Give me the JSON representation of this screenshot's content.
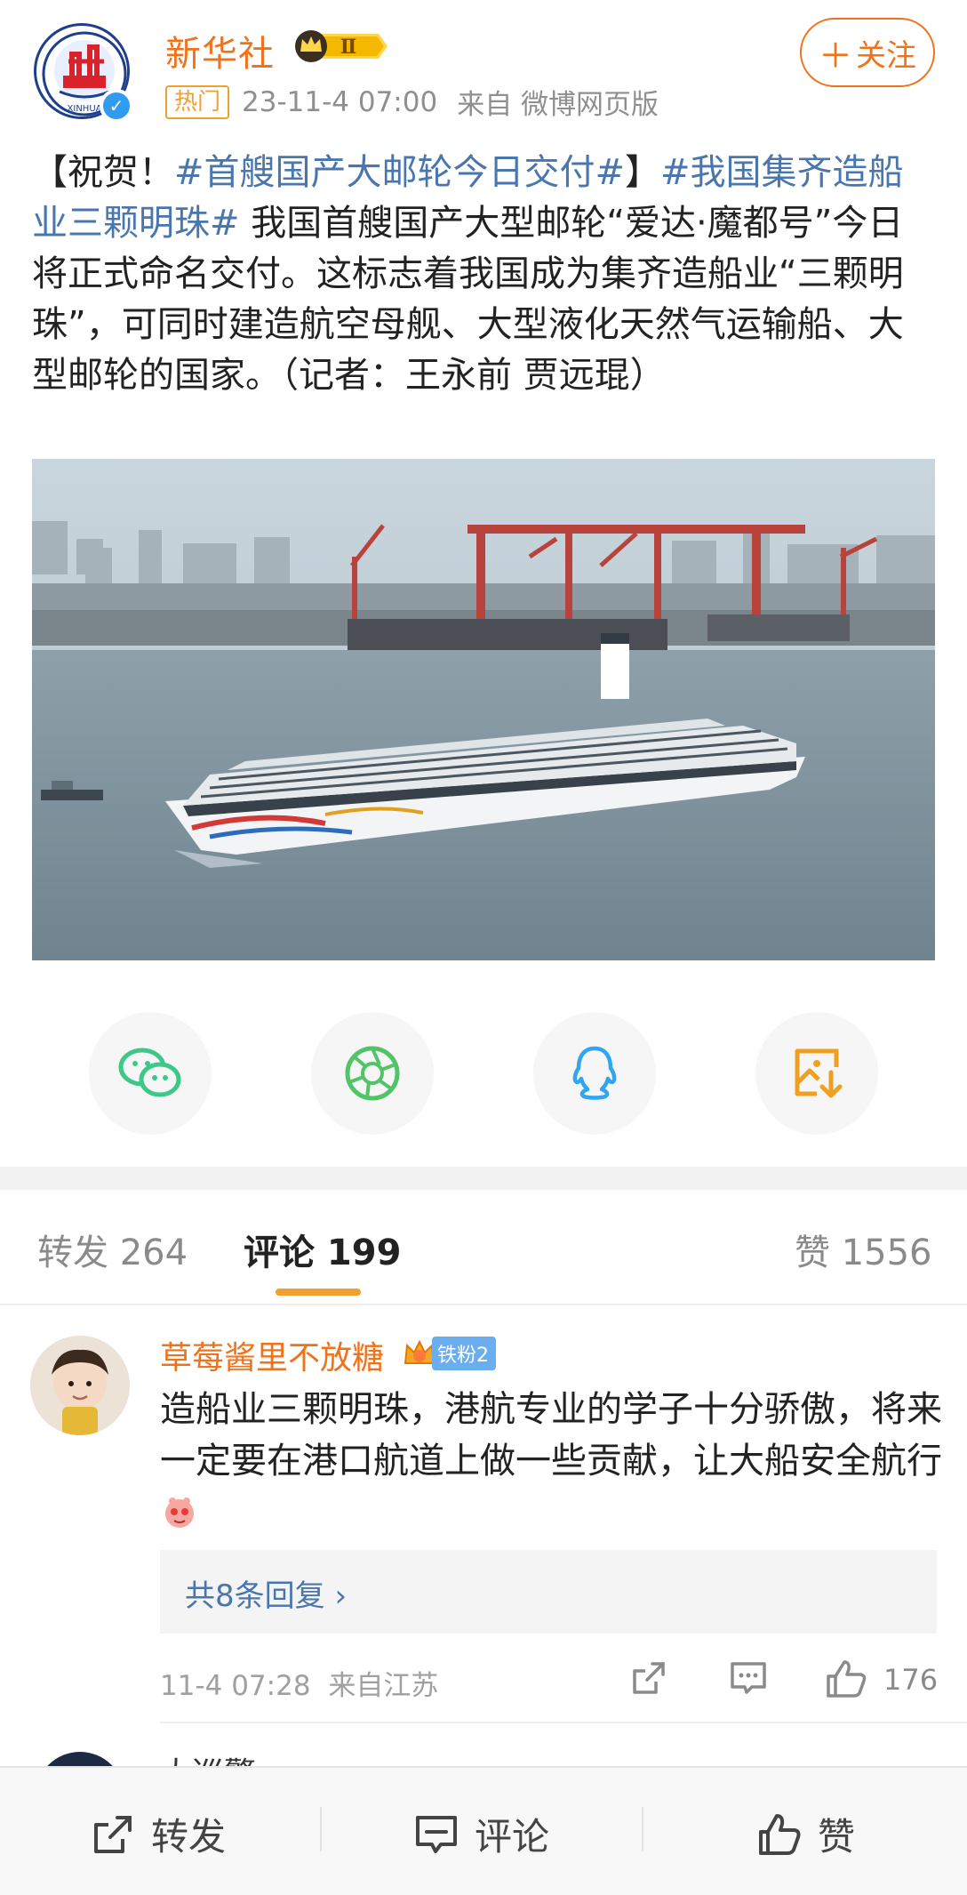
{
  "account": {
    "name": "新华社",
    "vip_level": "Ⅱ",
    "logo_text": "XINHUA",
    "follow_label": "关注",
    "hot_tag": "热门",
    "time": "23-11-4 07:00",
    "source": "来自 微博网页版"
  },
  "post": {
    "segments": [
      {
        "text": "【祝贺！",
        "tag": false
      },
      {
        "text": "#首艘国产大邮轮今日交付#",
        "tag": true
      },
      {
        "text": "】",
        "tag": false
      },
      {
        "text": "#我国集齐造船业三颗明珠#",
        "tag": true
      },
      {
        "text": " 我国首艘国产大型邮轮“爱达·魔都号”今日将正式命名交付。这标志着我国成为集齐造船业“三颗明珠”，可同时建造航空母舰、大型液化天然气运输船、大型邮轮的国家。（记者：王永前 贾远琨）",
        "tag": false
      }
    ]
  },
  "share": [
    {
      "name": "wechat-icon",
      "color": "#3dc88a"
    },
    {
      "name": "moments-icon",
      "color": "#52c468"
    },
    {
      "name": "qq-icon",
      "color": "#2fa6ef"
    },
    {
      "name": "save-image-icon",
      "color": "#f0a020"
    }
  ],
  "tabs": {
    "repost": "转发 264",
    "comments": "评论 199",
    "likes": "赞 1556"
  },
  "comment": {
    "name": "草莓酱里不放糖",
    "fan_badge": "铁粉2",
    "text": "造船业三颗明珠，港航专业的学子十分骄傲，将来一定要在港口航道上做一些贡献，让大船安全航行",
    "replies": "共8条回复 ›",
    "time": "11-4 07:28",
    "location": "来自江苏",
    "likes": "176"
  },
  "next_comment": {
    "name": "大巡警"
  },
  "bottom_bar": {
    "repost": "转发",
    "comment": "评论",
    "like": "赞"
  },
  "colors": {
    "accent": "#f0731b",
    "link": "#4a76ae",
    "tab_indicator": "#f0a030"
  }
}
